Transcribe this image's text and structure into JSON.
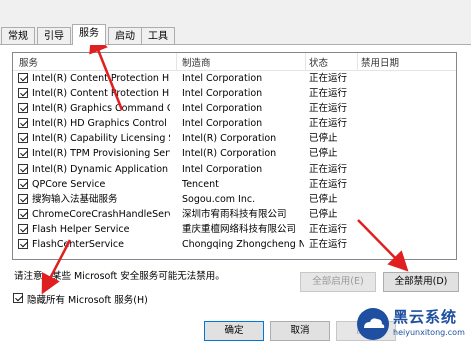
{
  "tabs": [
    {
      "label": "常规",
      "active": false
    },
    {
      "label": "引导",
      "active": false
    },
    {
      "label": "服务",
      "active": true
    },
    {
      "label": "启动",
      "active": false
    },
    {
      "label": "工具",
      "active": false
    }
  ],
  "table": {
    "headers": [
      "服务",
      "制造商",
      "状态",
      "禁用日期"
    ],
    "rows": [
      {
        "name": "Intel(R) Content Protection HECI ...",
        "vendor": "Intel Corporation",
        "status": "正在运行",
        "checked": true
      },
      {
        "name": "Intel(R) Content Protection HDCP...",
        "vendor": "Intel Corporation",
        "status": "正在运行",
        "checked": true
      },
      {
        "name": "Intel(R) Graphics Command Cent...",
        "vendor": "Intel Corporation",
        "status": "正在运行",
        "checked": true
      },
      {
        "name": "Intel(R) HD Graphics Control Pan...",
        "vendor": "Intel Corporation",
        "status": "正在运行",
        "checked": true
      },
      {
        "name": "Intel(R) Capability Licensing Servi...",
        "vendor": "Intel(R) Corporation",
        "status": "已停止",
        "checked": true
      },
      {
        "name": "Intel(R) TPM Provisioning Service",
        "vendor": "Intel(R) Corporation",
        "status": "已停止",
        "checked": true
      },
      {
        "name": "Intel(R) Dynamic Application Loa...",
        "vendor": "Intel Corporation",
        "status": "正在运行",
        "checked": true
      },
      {
        "name": "QPCore Service",
        "vendor": "Tencent",
        "status": "正在运行",
        "checked": true
      },
      {
        "name": "搜狗输入法基础服务",
        "vendor": "Sogou.com Inc.",
        "status": "已停止",
        "checked": true
      },
      {
        "name": "ChromeCoreCrashHandleService",
        "vendor": "深圳市宥雨科技有限公司",
        "status": "已停止",
        "checked": true
      },
      {
        "name": "Flash Helper Service",
        "vendor": "重庆重檀网络科技有限公司",
        "status": "正在运行",
        "checked": true
      },
      {
        "name": "FlashCenterService",
        "vendor": "Chongqing Zhongcheng N...",
        "status": "正在运行",
        "checked": true
      }
    ]
  },
  "note": "请注意，某些 Microsoft 安全服务可能无法禁用。",
  "buttons": {
    "enable_all": "全部启用(E)",
    "disable_all": "全部禁用(D)",
    "ok": "确定",
    "cancel": "取消",
    "apply": "应用"
  },
  "hide_ms": {
    "label": "隐藏所有 Microsoft 服务(H)",
    "checked": true
  },
  "watermark": {
    "title": "黑云系统",
    "url": "heiyunxitong.com"
  },
  "colors": {
    "annotation_arrow": "#e02020",
    "focus_border": "#0078d7",
    "watermark": "#1e4fa0"
  }
}
